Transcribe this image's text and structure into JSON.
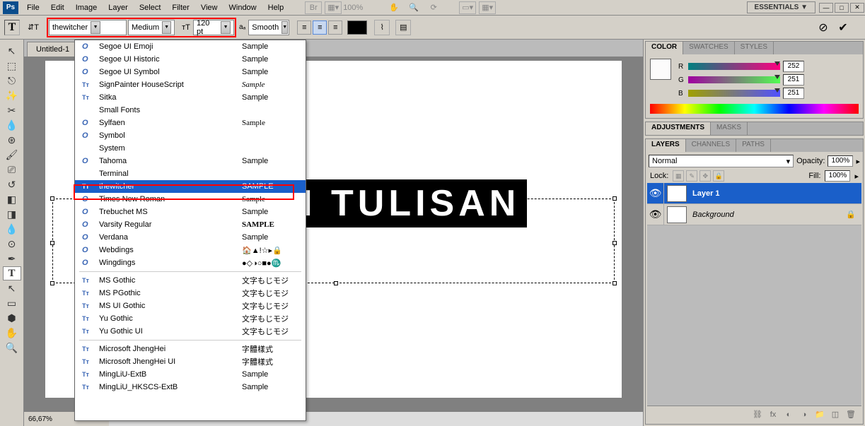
{
  "menubar": {
    "items": [
      "File",
      "Edit",
      "Image",
      "Layer",
      "Select",
      "Filter",
      "View",
      "Window",
      "Help"
    ],
    "zoom_menu": "100%",
    "workspace": "ESSENTIALS ▼"
  },
  "optbar": {
    "font": "thewitcher",
    "style": "Medium",
    "size": "120 pt",
    "aa": "Smooth"
  },
  "doc": {
    "tab": "Untitled-1",
    "canvas_text": "H TULISAN",
    "zoom": "66,67%"
  },
  "fonts": [
    {
      "i": "O",
      "n": "Segoe UI Emoji",
      "s": "Sample"
    },
    {
      "i": "O",
      "n": "Segoe UI Historic",
      "s": "Sample"
    },
    {
      "i": "O",
      "n": "Segoe UI Symbol",
      "s": "Sample"
    },
    {
      "i": "T",
      "n": "SignPainter HouseScript",
      "s": "Sample",
      "style": "font-style:italic;font-family:cursive"
    },
    {
      "i": "T",
      "n": "Sitka",
      "s": "Sample"
    },
    {
      "i": "",
      "n": "Small Fonts",
      "s": ""
    },
    {
      "i": "O",
      "n": "Sylfaen",
      "s": "Sample",
      "style": "font-family:serif"
    },
    {
      "i": "O",
      "n": "Symbol",
      "s": ""
    },
    {
      "i": "",
      "n": "System",
      "s": ""
    },
    {
      "i": "O",
      "n": "Tahoma",
      "s": "Sample"
    },
    {
      "i": "",
      "n": "Terminal",
      "s": ""
    },
    {
      "i": "T",
      "n": "thewitcher",
      "s": "SAMPLE",
      "sel": true
    },
    {
      "i": "O",
      "n": "Times New Roman",
      "s": "Sample",
      "style": "font-family:serif"
    },
    {
      "i": "O",
      "n": "Trebuchet MS",
      "s": "Sample"
    },
    {
      "i": "O",
      "n": "Varsity Regular",
      "s": "SAMPLE",
      "style": "font-weight:bold;font-family:serif"
    },
    {
      "i": "O",
      "n": "Verdana",
      "s": "Sample"
    },
    {
      "i": "O",
      "n": "Webdings",
      "s": "🏠▲!☆▸🔒"
    },
    {
      "i": "O",
      "n": "Wingdings",
      "s": "●◇◑○■●♏"
    },
    {
      "hr": true
    },
    {
      "i": "T",
      "n": "MS Gothic",
      "s": "文字もじモジ"
    },
    {
      "i": "T",
      "n": "MS PGothic",
      "s": "文字もじモジ"
    },
    {
      "i": "T",
      "n": "MS UI Gothic",
      "s": "文字もじモジ"
    },
    {
      "i": "T",
      "n": "Yu Gothic",
      "s": "文字もじモジ"
    },
    {
      "i": "T",
      "n": "Yu Gothic UI",
      "s": "文字もじモジ"
    },
    {
      "hr": true
    },
    {
      "i": "T",
      "n": "Microsoft JhengHei",
      "s": "字體樣式"
    },
    {
      "i": "T",
      "n": "Microsoft JhengHei UI",
      "s": "字體樣式"
    },
    {
      "i": "T",
      "n": "MingLiU-ExtB",
      "s": "Sample"
    },
    {
      "i": "T",
      "n": "MingLiU_HKSCS-ExtB",
      "s": "Sample"
    }
  ],
  "color": {
    "tabs": [
      "COLOR",
      "SWATCHES",
      "STYLES"
    ],
    "r": "252",
    "g": "251",
    "b": "251"
  },
  "adj": {
    "tabs": [
      "ADJUSTMENTS",
      "MASKS"
    ]
  },
  "layers": {
    "tabs": [
      "LAYERS",
      "CHANNELS",
      "PATHS"
    ],
    "mode": "Normal",
    "opacity_lbl": "Opacity:",
    "opacity": "100%",
    "lock_lbl": "Lock:",
    "fill_lbl": "Fill:",
    "fill": "100%",
    "rows": [
      {
        "name": "Layer 1",
        "t": "T",
        "sel": true
      },
      {
        "name": "Background",
        "t": "",
        "sel": false
      }
    ]
  }
}
